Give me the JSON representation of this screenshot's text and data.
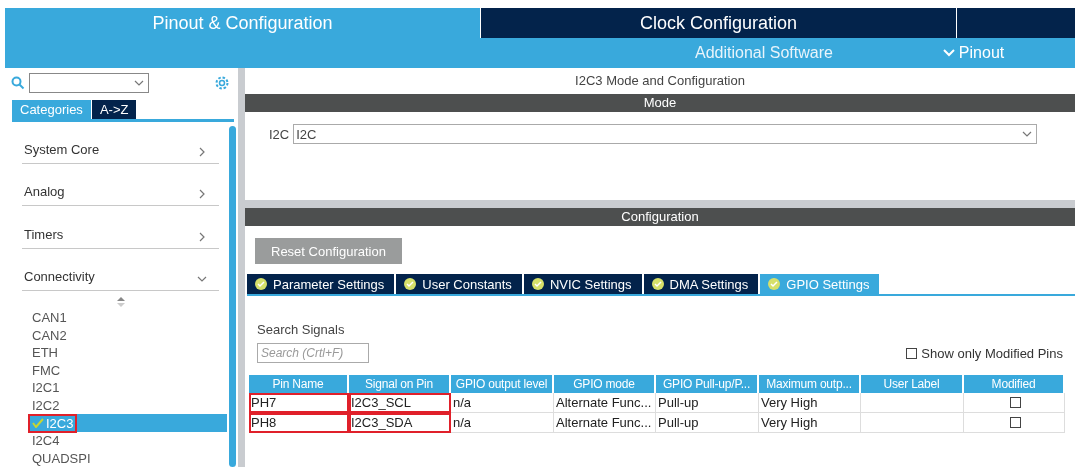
{
  "top_tabs": [
    {
      "label": "Pinout & Configuration",
      "selected": true
    },
    {
      "label": "Clock Configuration",
      "selected": false
    }
  ],
  "sub_nav": {
    "additional": "Additional Software",
    "pinout": "Pinout"
  },
  "sidebar": {
    "view_tabs": [
      {
        "label": "Categories",
        "selected": true
      },
      {
        "label": "A->Z",
        "selected": false
      }
    ],
    "categories": [
      {
        "label": "System Core",
        "expanded": false
      },
      {
        "label": "Analog",
        "expanded": false
      },
      {
        "label": "Timers",
        "expanded": false
      },
      {
        "label": "Connectivity",
        "expanded": true
      }
    ],
    "items": [
      {
        "label": "CAN1",
        "selected": false,
        "enabled": false,
        "highlighted": false
      },
      {
        "label": "CAN2",
        "selected": false,
        "enabled": false,
        "highlighted": false
      },
      {
        "label": "ETH",
        "selected": false,
        "enabled": false,
        "highlighted": false
      },
      {
        "label": "FMC",
        "selected": false,
        "enabled": false,
        "highlighted": false
      },
      {
        "label": "I2C1",
        "selected": false,
        "enabled": false,
        "highlighted": false
      },
      {
        "label": "I2C2",
        "selected": false,
        "enabled": false,
        "highlighted": false
      },
      {
        "label": "I2C3",
        "selected": true,
        "enabled": true,
        "highlighted": true
      },
      {
        "label": "I2C4",
        "selected": false,
        "enabled": false,
        "highlighted": false
      },
      {
        "label": "QUADSPI",
        "selected": false,
        "enabled": false,
        "highlighted": false
      }
    ]
  },
  "main": {
    "title": "I2C3 Mode and Configuration",
    "mode_header": "Mode",
    "mode_label": "I2C",
    "mode_value": "I2C",
    "config_header": "Configuration",
    "reset_button": "Reset Configuration",
    "tabs": [
      {
        "label": "Parameter Settings",
        "selected": false
      },
      {
        "label": "User Constants",
        "selected": false
      },
      {
        "label": "NVIC Settings",
        "selected": false
      },
      {
        "label": "DMA Settings",
        "selected": false
      },
      {
        "label": "GPIO Settings",
        "selected": true
      }
    ],
    "search_label": "Search Signals",
    "search_placeholder": "Search (Crtl+F)",
    "show_modified": {
      "label": "Show only Modified Pins",
      "checked": false
    },
    "table": {
      "columns": [
        "Pin Name",
        "Signal on Pin",
        "GPIO output level",
        "GPIO mode",
        "GPIO Pull-up/P...",
        "Maximum outp...",
        "User Label",
        "Modified"
      ],
      "rows": [
        {
          "cells": [
            "PH7",
            "I2C3_SCL",
            "n/a",
            "Alternate Func...",
            "Pull-up",
            "Very High",
            ""
          ],
          "modified": false,
          "highlighted": true
        },
        {
          "cells": [
            "PH8",
            "I2C3_SDA",
            "n/a",
            "Alternate Func...",
            "Pull-up",
            "Very High",
            ""
          ],
          "modified": false,
          "highlighted": true
        }
      ]
    }
  }
}
